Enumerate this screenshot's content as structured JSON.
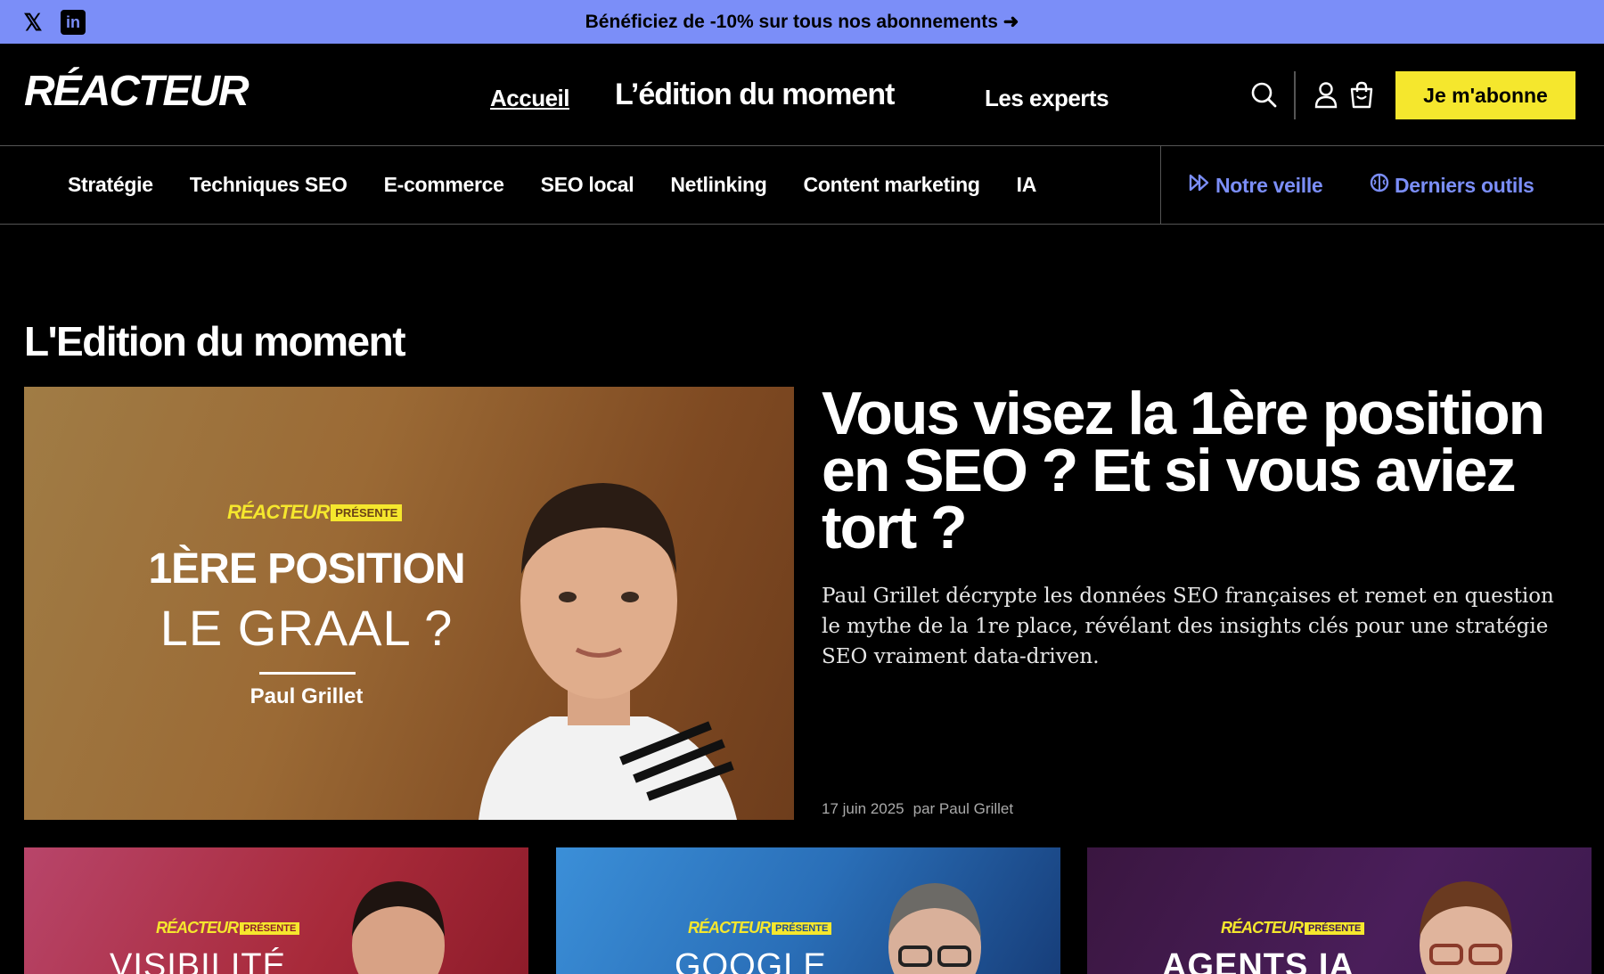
{
  "promo": {
    "text": "Bénéficiez de -10% sur tous nos abonnements ➜",
    "social": [
      {
        "icon": "x-icon",
        "glyph": "𝕏"
      },
      {
        "icon": "linkedin-icon",
        "glyph": "in"
      }
    ]
  },
  "header": {
    "logo": "RÉACTEUR",
    "nav": {
      "accueil": "Accueil",
      "edition": "L’édition du moment",
      "experts": "Les experts"
    },
    "subscribe_label": "Je m'abonne",
    "icons": [
      "search-icon",
      "user-icon",
      "cart-icon"
    ]
  },
  "categories": {
    "items": [
      "Stratégie",
      "Techniques SEO",
      "E-commerce",
      "SEO local",
      "Netlinking",
      "Content marketing",
      "IA"
    ],
    "veille": "Notre veille",
    "outils": "Derniers outils",
    "accent_color": "#7b8ef8"
  },
  "section": {
    "title": "L'Edition du moment"
  },
  "featured": {
    "image": {
      "brand": "RÉACTEUR",
      "presents": "PRÉSENTE",
      "line1": "1ÈRE POSITION",
      "line2": "LE GRAAL ?",
      "author": "Paul Grillet"
    },
    "title": "Vous visez la 1ère position en SEO ? Et si vous aviez tort ?",
    "excerpt": "Paul Grillet décrypte les données SEO françaises et remet en question le mythe de la 1re place, révélant des insights clés pour une stratégie SEO vraiment data-driven.",
    "date": "17 juin 2025",
    "byline": "par Paul Grillet"
  },
  "cards": [
    {
      "brand": "RÉACTEUR",
      "presents": "PRÉSENTE",
      "headline": "VISIBILITÉ"
    },
    {
      "brand": "RÉACTEUR",
      "presents": "PRÉSENTE",
      "headline": "GOOGLE"
    },
    {
      "brand": "RÉACTEUR",
      "presents": "PRÉSENTE",
      "headline": "AGENTS IA"
    }
  ],
  "colors": {
    "promo_bg": "#7b8ef8",
    "subscribe_bg": "#f5e72d",
    "brand_yellow": "#f5e72d"
  }
}
